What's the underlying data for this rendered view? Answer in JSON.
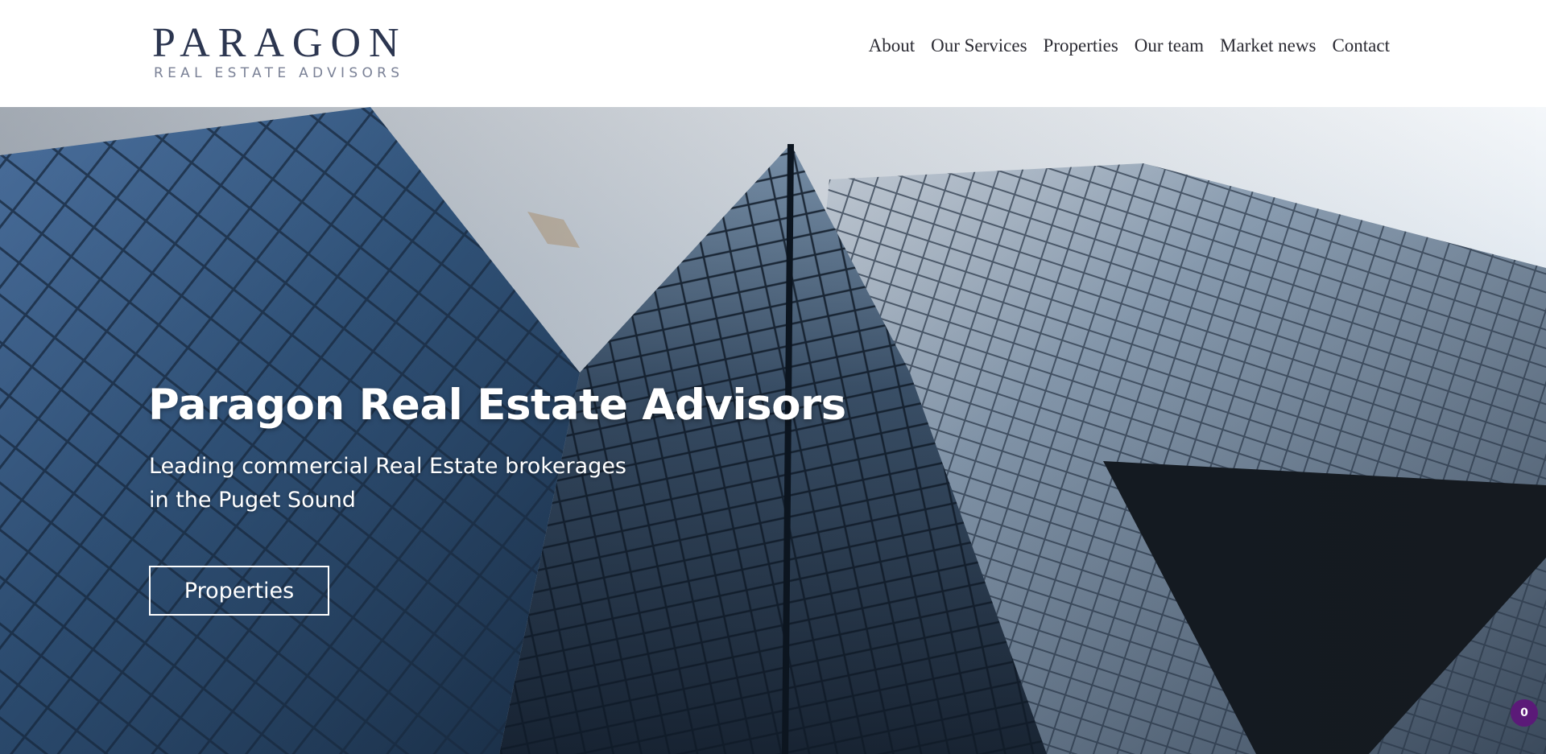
{
  "brand": {
    "name": "PARAGON",
    "tagline": "REAL ESTATE ADVISORS"
  },
  "nav": {
    "items": [
      {
        "label": "About"
      },
      {
        "label": "Our Services"
      },
      {
        "label": "Properties"
      },
      {
        "label": "Our team"
      },
      {
        "label": "Market news"
      },
      {
        "label": "Contact"
      }
    ]
  },
  "hero": {
    "title": "Paragon Real Estate Advisors",
    "subtitle_line1": "Leading commercial Real Estate brokerages",
    "subtitle_line2": "in the Puget Sound",
    "button_label": "Properties",
    "background": "glass-skyscrapers-photo"
  },
  "cart": {
    "count": "0",
    "badge_color": "#5b1a78"
  },
  "colors": {
    "brand_text": "#2c3650",
    "tagline_text": "#7a8196",
    "nav_text": "#2b2b33"
  }
}
